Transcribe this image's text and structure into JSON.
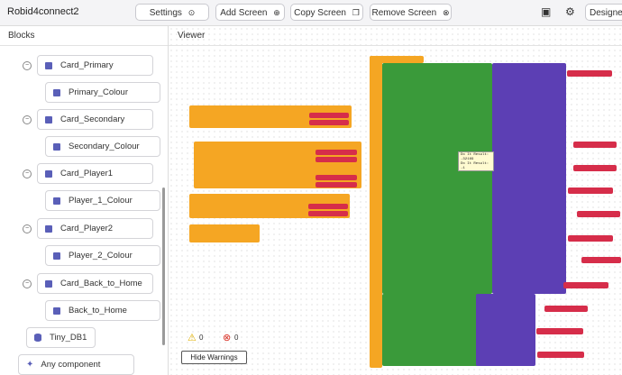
{
  "app": {
    "title": "Robid4connect2"
  },
  "toolbar": {
    "screen_select": "Settings",
    "add_screen": "Add Screen",
    "copy_screen": "Copy Screen",
    "remove_screen": "Remove Screen",
    "designer": "Designe"
  },
  "blocks_panel": {
    "header": "Blocks",
    "tree": [
      {
        "label": "Card_Primary",
        "kind": "parent"
      },
      {
        "label": "Primary_Colour",
        "kind": "child"
      },
      {
        "label": "Card_Secondary",
        "kind": "parent"
      },
      {
        "label": "Secondary_Colour",
        "kind": "child"
      },
      {
        "label": "Card_Player1",
        "kind": "parent"
      },
      {
        "label": "Player_1_Colour",
        "kind": "child"
      },
      {
        "label": "Card_Player2",
        "kind": "parent"
      },
      {
        "label": "Player_2_Colour",
        "kind": "child"
      },
      {
        "label": "Card_Back_to_Home",
        "kind": "parent"
      },
      {
        "label": "Back_to_Home",
        "kind": "child"
      },
      {
        "label": "Tiny_DB1",
        "kind": "db"
      },
      {
        "label": "Any component",
        "kind": "any"
      }
    ]
  },
  "viewer": {
    "header": "Viewer",
    "warnings": {
      "warning_count": "0",
      "error_count": "0",
      "hide_label": "Hide Warnings"
    },
    "tooltip": [
      "Do It Result:",
      "-32169",
      "",
      "Do It Result: -1"
    ]
  },
  "colors": {
    "event": "#f5a623",
    "component": "#3a9a3a",
    "tinydb": "#5c3fb4",
    "text": "#d62d4a"
  }
}
